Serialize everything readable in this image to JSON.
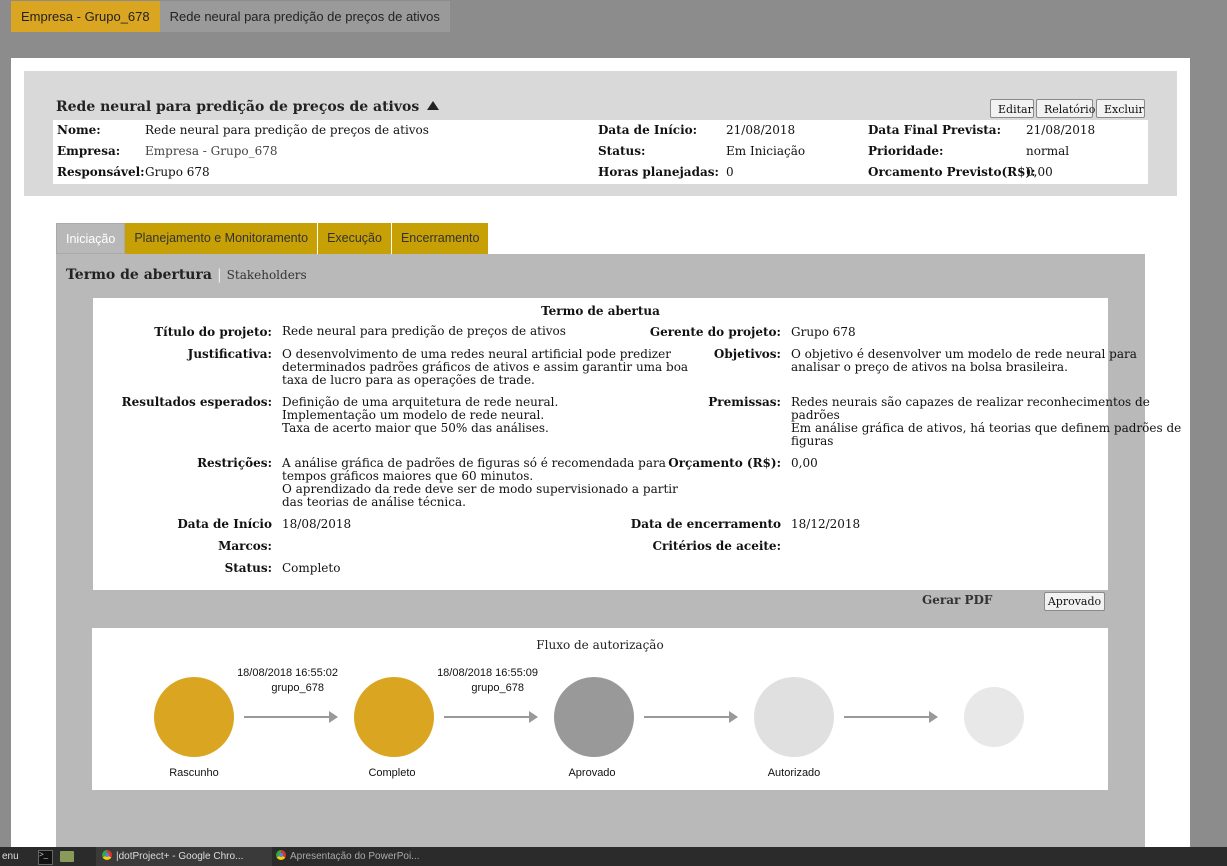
{
  "breadcrumb": {
    "company": "Empresa - Grupo_678",
    "project": "Rede neural para predição de preços de ativos"
  },
  "project": {
    "title": "Rede neural para predição de preços de ativos",
    "buttons": {
      "edit": "Editar",
      "report": "Relatório",
      "delete": "Excluir"
    },
    "info": {
      "nome_label": "Nome:",
      "nome": "Rede neural para predição de preços de ativos",
      "empresa_label": "Empresa:",
      "empresa": "Empresa - Grupo_678",
      "responsavel_label": "Responsável:",
      "responsavel": "Grupo 678",
      "data_inicio_label": "Data de Início:",
      "data_inicio": "21/08/2018",
      "status_label": "Status:",
      "status": "Em Iniciação",
      "horas_label": "Horas planejadas:",
      "horas": "0",
      "data_final_label": "Data Final Prevista:",
      "data_final": "21/08/2018",
      "prioridade_label": "Prioridade:",
      "prioridade": "normal",
      "orcamento_label": "Orcamento Previsto(R$):",
      "orcamento": "0,00"
    }
  },
  "tabs": [
    {
      "label": "Iniciação",
      "active": true
    },
    {
      "label": "Planejamento e Monitoramento"
    },
    {
      "label": "Execução"
    },
    {
      "label": "Encerramento"
    }
  ],
  "subtabs": {
    "main": "Termo de abertura",
    "sep": "|",
    "secondary": "Stakeholders"
  },
  "termo": {
    "title": "Termo de abertua",
    "titulo_label": "Título do projeto:",
    "titulo": "Rede neural para predição de preços de ativos",
    "justificativa_label": "Justificativa:",
    "justificativa": [
      "O desenvolvimento de uma redes neural artificial pode predizer",
      "determinados padrões gráficos de ativos e assim garantir uma boa",
      "taxa de lucro para as operações de trade."
    ],
    "resultados_label": "Resultados esperados:",
    "resultados": [
      "Definição de uma arquitetura de rede neural.",
      "Implementação um modelo de rede neural.",
      "Taxa de acerto maior que 50% das análises."
    ],
    "restricoes_label": "Restrições:",
    "restricoes": [
      "A análise gráfica de padrões de figuras só é recomendada para",
      "tempos gráficos maiores que 60 minutos.",
      "O aprendizado da rede deve ser de modo supervisionado a partir",
      "das teorias de análise técnica."
    ],
    "data_inicio_label": "Data de Início",
    "data_inicio": "18/08/2018",
    "marcos_label": "Marcos:",
    "status_label": "Status:",
    "status": "Completo",
    "gerente_label": "Gerente do projeto:",
    "gerente": "Grupo 678",
    "objetivos_label": "Objetivos:",
    "objetivos": [
      "O objetivo é desenvolver um modelo de rede neural para",
      "analisar o preço de ativos na bolsa brasileira."
    ],
    "premissas_label": "Premissas:",
    "premissas": [
      "Redes neurais são capazes de realizar reconhecimentos de",
      "padrões",
      "Em análise gráfica de ativos, há teorias que definem padrões de",
      "figuras"
    ],
    "orcamento_label": "Orçamento (R$):",
    "orcamento": "0,00",
    "data_encerramento_label": "Data de encerramento",
    "data_encerramento": "18/12/2018",
    "criterios_label": "Critérios de aceite:"
  },
  "actions": {
    "gerar_pdf": "Gerar PDF",
    "aprovado": "Aprovado"
  },
  "fluxo": {
    "title": "Fluxo de autorização",
    "colors": {
      "done": "#daa520",
      "approved": "#999999",
      "pending": "#e0e0e0",
      "pending_small": "#e8e8e8"
    },
    "nodes": [
      {
        "label": "Rascunho",
        "state": "done"
      },
      {
        "label": "Completo",
        "state": "done"
      },
      {
        "label": "Aprovado",
        "state": "approved"
      },
      {
        "label": "Autorizado",
        "state": "pending"
      },
      {
        "label": "",
        "state": "pending_small"
      }
    ],
    "transitions": [
      {
        "time": "18/08/2018 16:55:02",
        "user": "grupo_678"
      },
      {
        "time": "18/08/2018 16:55:09",
        "user": "grupo_678"
      }
    ]
  },
  "taskbar": {
    "menu": "enu",
    "items": [
      "|dotProject+ - Google Chro...",
      "Apresentação do PowerPoi..."
    ]
  }
}
